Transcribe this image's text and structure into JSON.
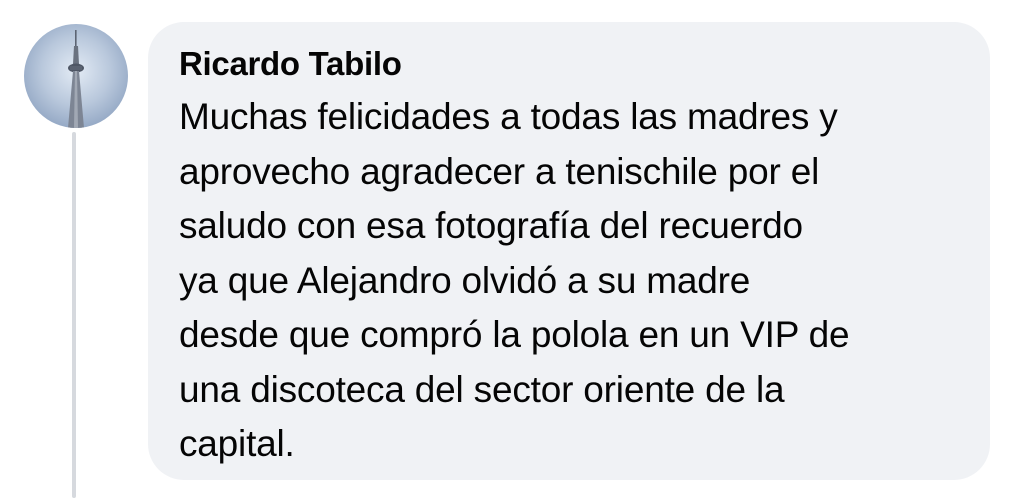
{
  "comment": {
    "author": "Ricardo Tabilo",
    "text_lines": [
      "Muchas felicidades a todas las madres y",
      "aprovecho agradecer a tenischile por el",
      "saludo con esa fotografía del recuerdo",
      "ya que Alejandro olvidó a su madre",
      "desde que compró la polola en un VIP de",
      "una discoteca del sector oriente de la",
      "capital."
    ]
  },
  "avatar": {
    "icon": "tower-photo-icon"
  },
  "colors": {
    "bubble_background": "#f0f2f5",
    "text": "#050505",
    "thread_line": "#d6d9de"
  }
}
